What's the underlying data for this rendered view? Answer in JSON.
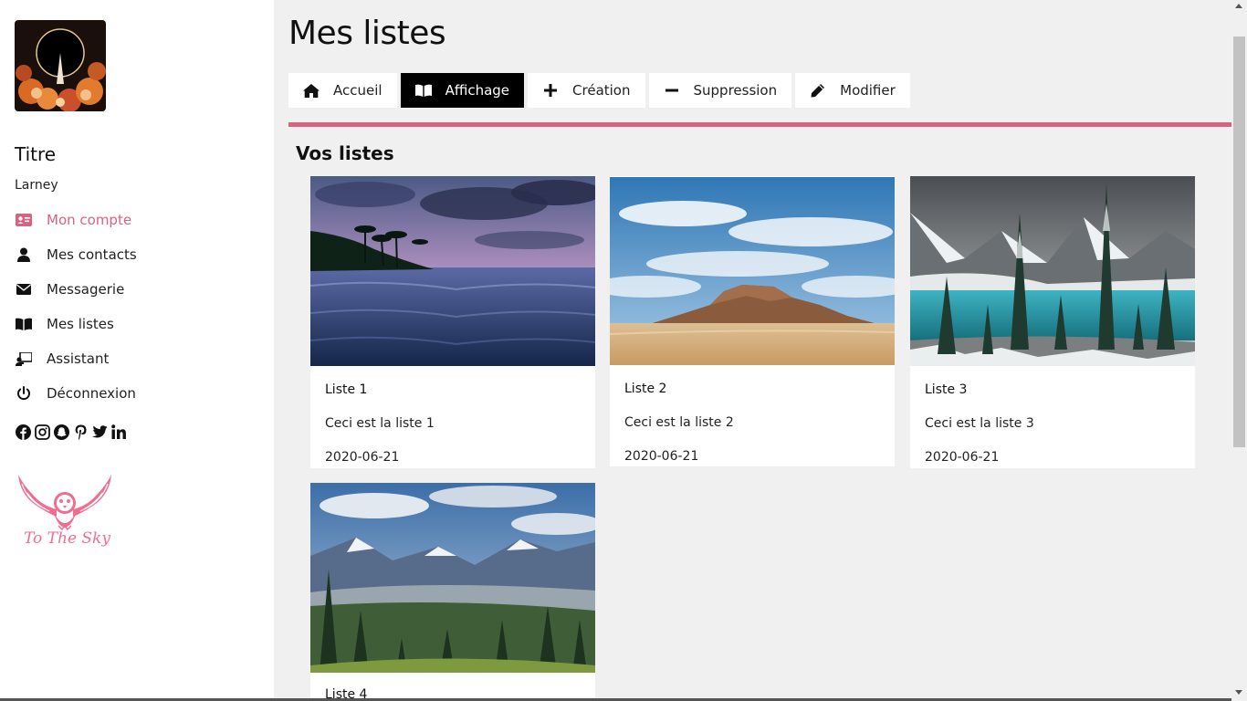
{
  "sidebar": {
    "title": "Titre",
    "username": "Larney",
    "nav": [
      {
        "label": "Mon compte",
        "icon": "id-card-icon",
        "active": true
      },
      {
        "label": "Mes contacts",
        "icon": "user-icon"
      },
      {
        "label": "Messagerie",
        "icon": "envelope-icon"
      },
      {
        "label": "Mes listes",
        "icon": "book-open-icon"
      },
      {
        "label": "Assistant",
        "icon": "chalkboard-teacher-icon"
      },
      {
        "label": "Déconnexion",
        "icon": "power-icon"
      }
    ],
    "socials": [
      "facebook-icon",
      "instagram-icon",
      "snapchat-icon",
      "pinterest-icon",
      "twitter-icon",
      "linkedin-icon"
    ],
    "brand_text": "To The Sky"
  },
  "main": {
    "title": "Mes listes",
    "tabs": [
      {
        "label": "Accueil",
        "icon": "home-icon"
      },
      {
        "label": "Affichage",
        "icon": "book-open-icon",
        "active": true
      },
      {
        "label": "Création",
        "icon": "plus-icon"
      },
      {
        "label": "Suppression",
        "icon": "minus-icon"
      },
      {
        "label": "Modifier",
        "icon": "pencil-icon"
      }
    ],
    "section_title": "Vos listes",
    "cards": [
      {
        "name": "Liste 1",
        "description": "Ceci est la liste 1",
        "date": "2020-06-21",
        "image": "tropical beach at dusk"
      },
      {
        "name": "Liste 2",
        "description": "Ceci est la liste 2",
        "date": "2020-06-21",
        "image": "desert mesa under blue sky"
      },
      {
        "name": "Liste 3",
        "description": "Ceci est la liste 3",
        "date": "2020-06-21",
        "image": "snowy mountain lake with pines"
      },
      {
        "name": "Liste 4",
        "image": "mountain valley with forest"
      }
    ]
  },
  "colors": {
    "accent": "#d9627f",
    "active_tab_bg": "#000000",
    "page_bg": "#f0f0f0",
    "sidebar_bg": "#ffffff"
  }
}
